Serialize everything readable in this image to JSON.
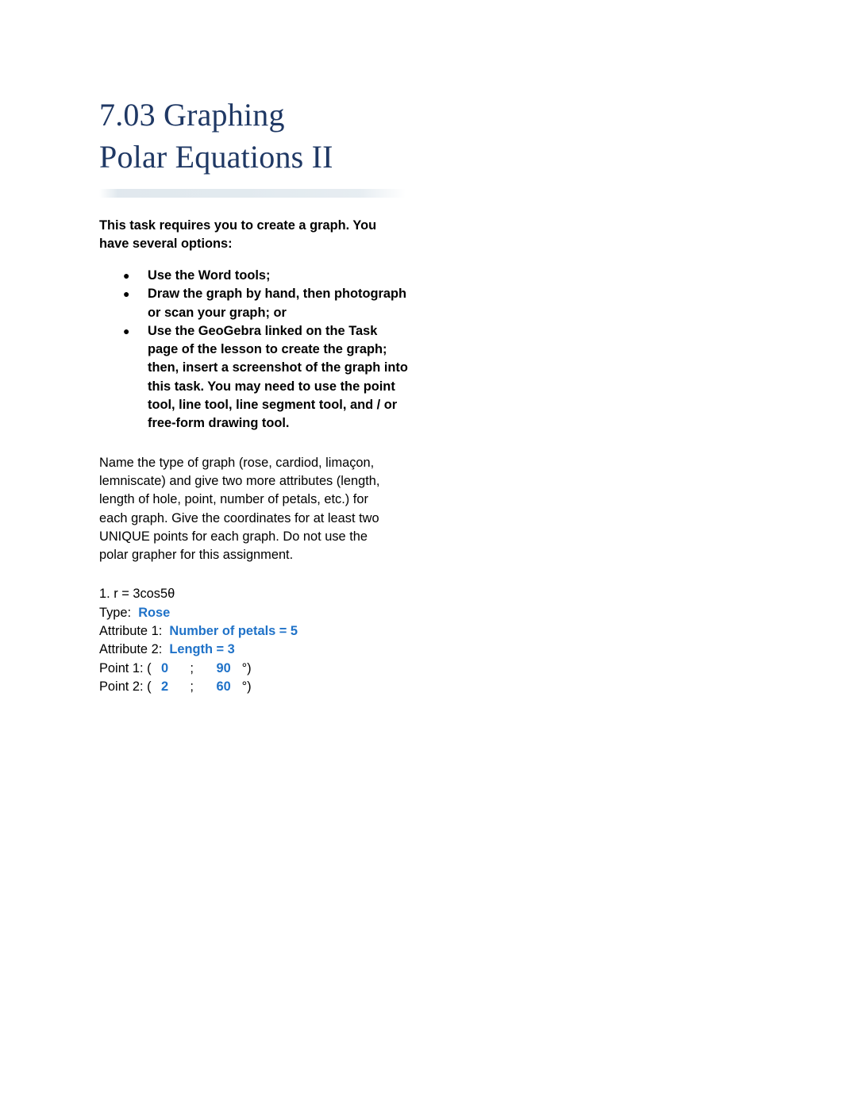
{
  "document": {
    "title_line_1": "7.03 Graphing",
    "title_line_2": "Polar Equations II",
    "title_color": "#1f3864",
    "accent_color": "#1f72c8",
    "background_color": "#ffffff"
  },
  "intro": {
    "text": "This task requires you to create a graph. You have several options:"
  },
  "bullets": [
    {
      "marker": "●",
      "text": "Use the Word tools;"
    },
    {
      "marker": "●",
      "text": "Draw the graph by hand, then photograph or scan your graph; or"
    },
    {
      "marker": "●",
      "text": "Use the GeoGebra linked on the Task page of the lesson to create the graph; then, insert a screenshot of the graph into this task. You may need to use the point tool, line tool, line segment tool, and / or free-form drawing tool."
    }
  ],
  "instructions": {
    "text": "Name the type of graph (rose, cardiod, limaçon, lemniscate) and give two more attributes (length, length of hole, point, number of petals, etc.) for each graph.  Give the coordinates for at least two UNIQUE points for each graph. Do not use the polar grapher for this assignment."
  },
  "problem": {
    "equation": "1. r = 3cos5θ",
    "type_label": "Type:",
    "type_value": "Rose",
    "attribute_1_label": "Attribute 1:",
    "attribute_1_value": "Number of petals = 5",
    "attribute_2_label": "Attribute 2:",
    "attribute_2_value": "Length = 3",
    "point_1_label": "Point 1: (",
    "point_1_radius": "0",
    "point_1_separator": ";",
    "point_1_angle": "90",
    "point_1_suffix": "°)",
    "point_2_label": "Point 2: (",
    "point_2_radius": "2",
    "point_2_separator": ";",
    "point_2_angle": "60",
    "point_2_suffix": "°)"
  }
}
